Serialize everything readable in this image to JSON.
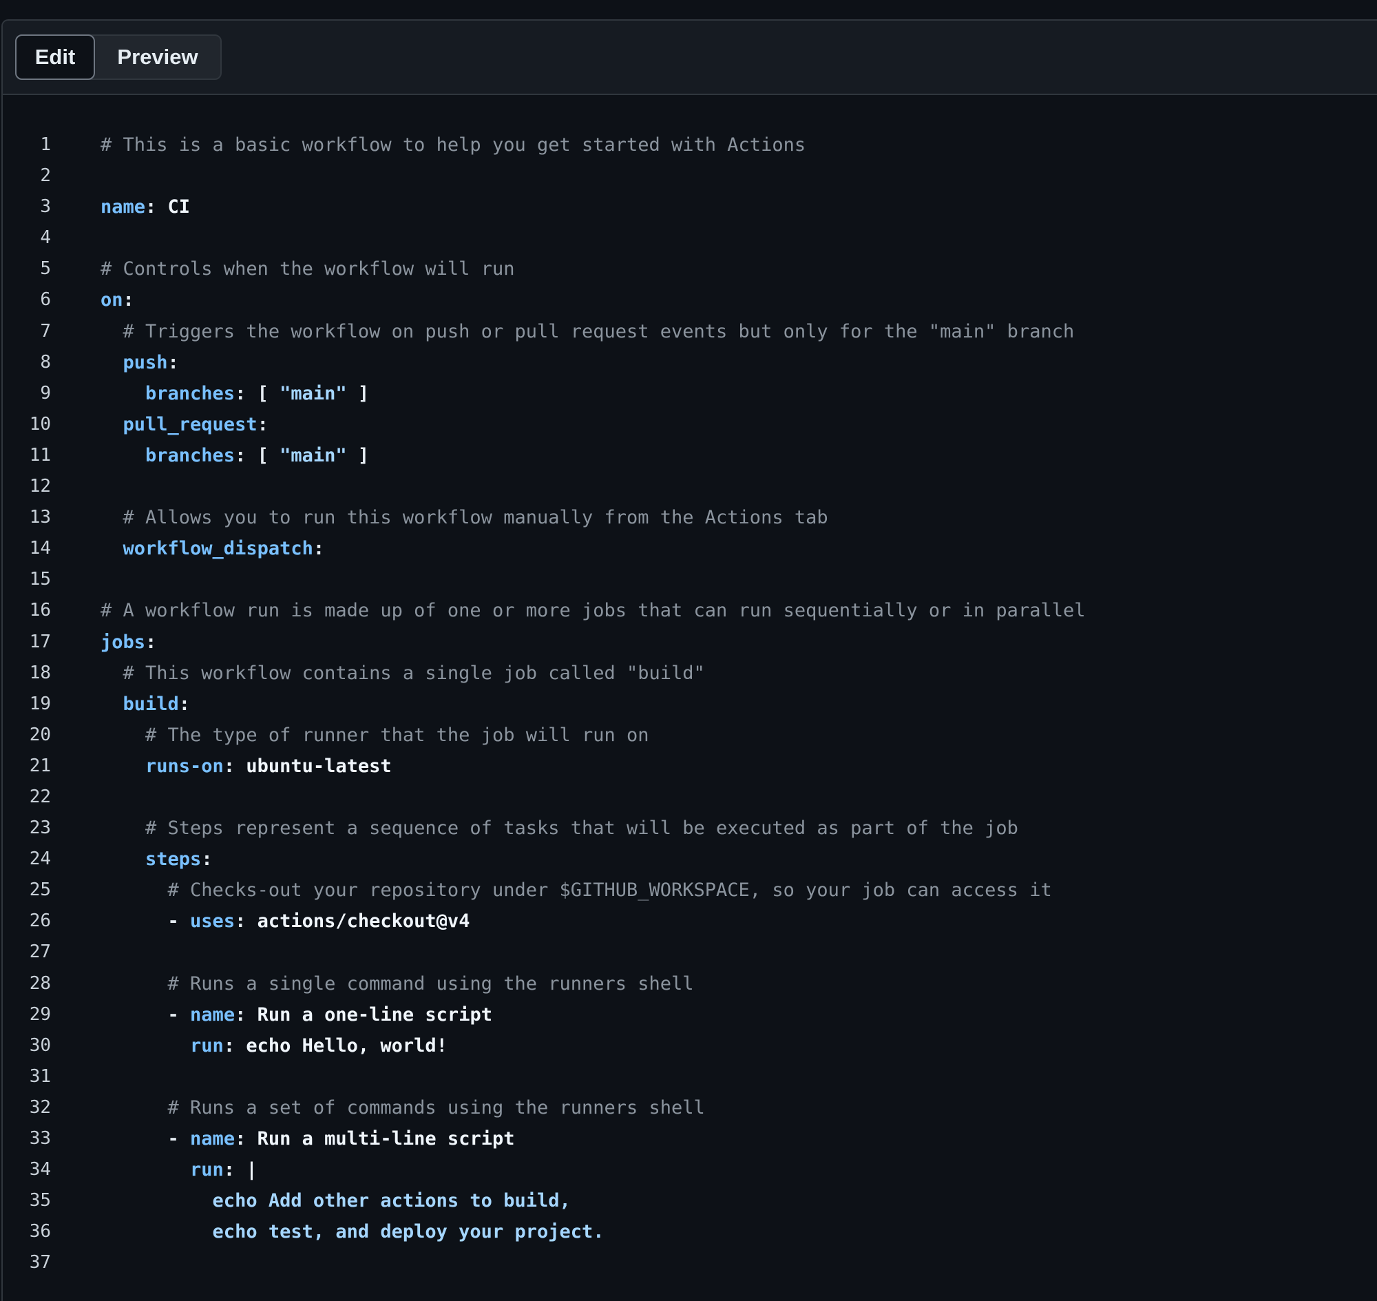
{
  "tabs": {
    "edit_label": "Edit",
    "preview_label": "Preview"
  },
  "colors": {
    "background": "#0d1117",
    "toolbar": "#161b22",
    "comment": "#8b949e",
    "key": "#79c0ff",
    "string": "#a5d6ff",
    "text": "#e6edf3"
  },
  "editor": {
    "lines": [
      {
        "n": "1",
        "tokens": [
          {
            "t": "c",
            "v": "# This is a basic workflow to help you get started with Actions"
          }
        ]
      },
      {
        "n": "2",
        "tokens": []
      },
      {
        "n": "3",
        "tokens": [
          {
            "t": "k",
            "v": "name"
          },
          {
            "t": "p",
            "v": ": "
          },
          {
            "t": "v",
            "v": "CI"
          }
        ]
      },
      {
        "n": "4",
        "tokens": []
      },
      {
        "n": "5",
        "tokens": [
          {
            "t": "c",
            "v": "# Controls when the workflow will run"
          }
        ]
      },
      {
        "n": "6",
        "tokens": [
          {
            "t": "k",
            "v": "on"
          },
          {
            "t": "p",
            "v": ":"
          }
        ]
      },
      {
        "n": "7",
        "tokens": [
          {
            "t": "c",
            "v": "  # Triggers the workflow on push or pull request events but only for the \"main\" branch"
          }
        ]
      },
      {
        "n": "8",
        "tokens": [
          {
            "t": "k",
            "v": "  push"
          },
          {
            "t": "p",
            "v": ":"
          }
        ]
      },
      {
        "n": "9",
        "tokens": [
          {
            "t": "k",
            "v": "    branches"
          },
          {
            "t": "p",
            "v": ": [ "
          },
          {
            "t": "s",
            "v": "\"main\""
          },
          {
            "t": "p",
            "v": " ]"
          }
        ]
      },
      {
        "n": "10",
        "tokens": [
          {
            "t": "k",
            "v": "  pull_request"
          },
          {
            "t": "p",
            "v": ":"
          }
        ]
      },
      {
        "n": "11",
        "tokens": [
          {
            "t": "k",
            "v": "    branches"
          },
          {
            "t": "p",
            "v": ": [ "
          },
          {
            "t": "s",
            "v": "\"main\""
          },
          {
            "t": "p",
            "v": " ]"
          }
        ]
      },
      {
        "n": "12",
        "tokens": []
      },
      {
        "n": "13",
        "tokens": [
          {
            "t": "c",
            "v": "  # Allows you to run this workflow manually from the Actions tab"
          }
        ]
      },
      {
        "n": "14",
        "tokens": [
          {
            "t": "k",
            "v": "  workflow_dispatch"
          },
          {
            "t": "p",
            "v": ":"
          }
        ]
      },
      {
        "n": "15",
        "tokens": []
      },
      {
        "n": "16",
        "tokens": [
          {
            "t": "c",
            "v": "# A workflow run is made up of one or more jobs that can run sequentially or in parallel"
          }
        ]
      },
      {
        "n": "17",
        "tokens": [
          {
            "t": "k",
            "v": "jobs"
          },
          {
            "t": "p",
            "v": ":"
          }
        ]
      },
      {
        "n": "18",
        "tokens": [
          {
            "t": "c",
            "v": "  # This workflow contains a single job called \"build\""
          }
        ]
      },
      {
        "n": "19",
        "tokens": [
          {
            "t": "k",
            "v": "  build"
          },
          {
            "t": "p",
            "v": ":"
          }
        ]
      },
      {
        "n": "20",
        "tokens": [
          {
            "t": "c",
            "v": "    # The type of runner that the job will run on"
          }
        ]
      },
      {
        "n": "21",
        "tokens": [
          {
            "t": "k",
            "v": "    runs-on"
          },
          {
            "t": "p",
            "v": ": "
          },
          {
            "t": "v",
            "v": "ubuntu-latest"
          }
        ]
      },
      {
        "n": "22",
        "tokens": []
      },
      {
        "n": "23",
        "tokens": [
          {
            "t": "c",
            "v": "    # Steps represent a sequence of tasks that will be executed as part of the job"
          }
        ]
      },
      {
        "n": "24",
        "tokens": [
          {
            "t": "k",
            "v": "    steps"
          },
          {
            "t": "p",
            "v": ":"
          }
        ]
      },
      {
        "n": "25",
        "tokens": [
          {
            "t": "c",
            "v": "      # Checks-out your repository under $GITHUB_WORKSPACE, so your job can access it"
          }
        ]
      },
      {
        "n": "26",
        "tokens": [
          {
            "t": "p",
            "v": "      - "
          },
          {
            "t": "k",
            "v": "uses"
          },
          {
            "t": "p",
            "v": ": "
          },
          {
            "t": "v",
            "v": "actions/checkout@v4"
          }
        ]
      },
      {
        "n": "27",
        "tokens": []
      },
      {
        "n": "28",
        "tokens": [
          {
            "t": "c",
            "v": "      # Runs a single command using the runners shell"
          }
        ]
      },
      {
        "n": "29",
        "tokens": [
          {
            "t": "p",
            "v": "      - "
          },
          {
            "t": "k",
            "v": "name"
          },
          {
            "t": "p",
            "v": ": "
          },
          {
            "t": "v",
            "v": "Run a one-line script"
          }
        ]
      },
      {
        "n": "30",
        "tokens": [
          {
            "t": "k",
            "v": "        run"
          },
          {
            "t": "p",
            "v": ": "
          },
          {
            "t": "v",
            "v": "echo Hello, world!"
          }
        ]
      },
      {
        "n": "31",
        "tokens": []
      },
      {
        "n": "32",
        "tokens": [
          {
            "t": "c",
            "v": "      # Runs a set of commands using the runners shell"
          }
        ]
      },
      {
        "n": "33",
        "tokens": [
          {
            "t": "p",
            "v": "      - "
          },
          {
            "t": "k",
            "v": "name"
          },
          {
            "t": "p",
            "v": ": "
          },
          {
            "t": "v",
            "v": "Run a multi-line script"
          }
        ]
      },
      {
        "n": "34",
        "tokens": [
          {
            "t": "k",
            "v": "        run"
          },
          {
            "t": "p",
            "v": ": "
          },
          {
            "t": "v",
            "v": "|"
          }
        ]
      },
      {
        "n": "35",
        "tokens": [
          {
            "t": "b",
            "v": "          echo Add other actions to build,"
          }
        ]
      },
      {
        "n": "36",
        "tokens": [
          {
            "t": "b",
            "v": "          echo test, and deploy your project."
          }
        ]
      },
      {
        "n": "37",
        "tokens": []
      }
    ]
  }
}
